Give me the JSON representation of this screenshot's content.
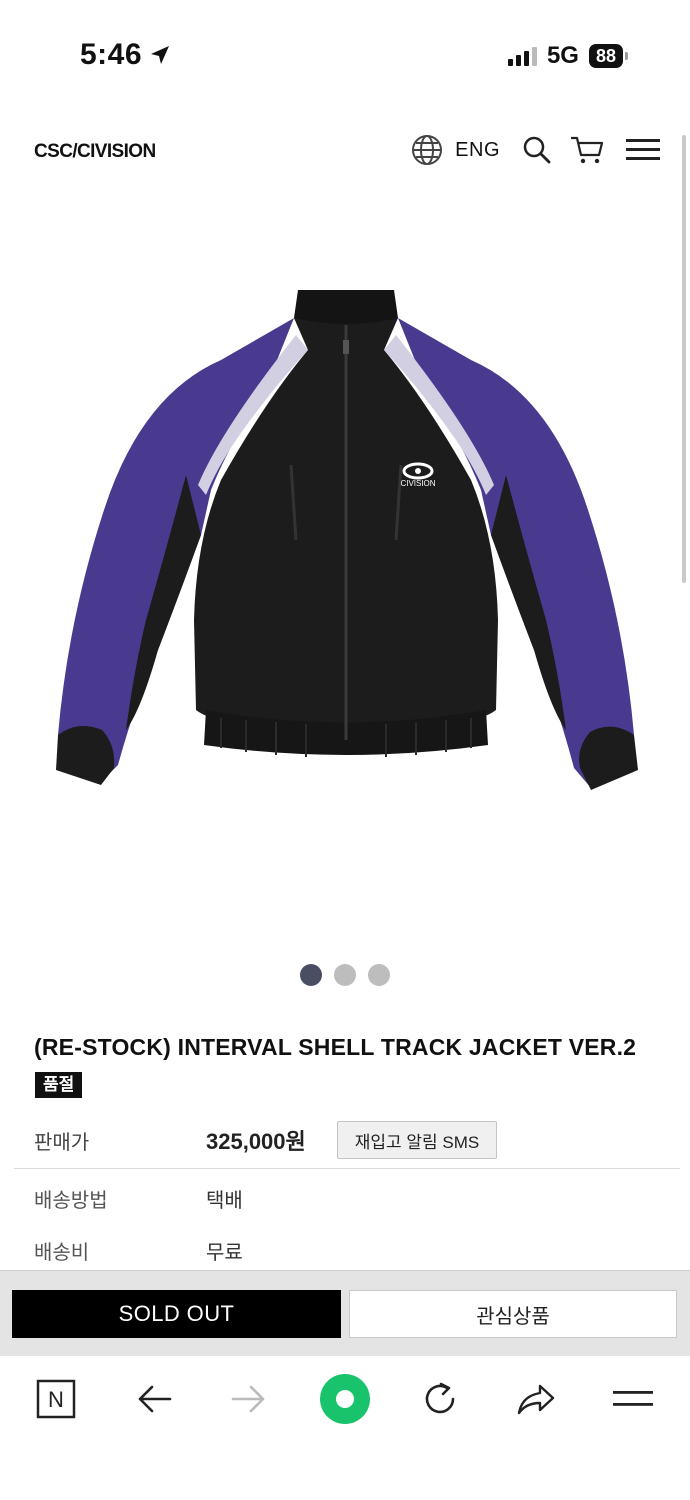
{
  "status_bar": {
    "time": "5:46",
    "network": "5G",
    "battery": "88"
  },
  "header": {
    "logo": "CSC/CIVISION",
    "language": "ENG"
  },
  "product": {
    "image_logo_text": "CIVISION",
    "image_count": 3,
    "active_image": 1,
    "title": "(RE-STOCK) INTERVAL SHELL TRACK JACKET VER.2",
    "badge": "품절",
    "price_label": "판매가",
    "price": "325,000원",
    "restock_button": "재입고 알림 SMS",
    "shipping_method_label": "배송방법",
    "shipping_method": "택배",
    "shipping_fee_label": "배송비",
    "shipping_fee": "무료"
  },
  "actions": {
    "sold_out": "SOLD OUT",
    "wishlist": "관심상품"
  },
  "browser_bar": {
    "home": "N",
    "icons": [
      "naver-icon",
      "back-arrow-icon",
      "forward-arrow-icon",
      "green-dot-icon",
      "reload-icon",
      "share-icon",
      "menu-icon"
    ]
  },
  "colors": {
    "jacket_black": "#1c1c1c",
    "jacket_purple": "#4a3a8f",
    "jacket_lavender": "#d3cfe2",
    "active_dot": "#4a4e63",
    "green_button": "#19c36b"
  }
}
